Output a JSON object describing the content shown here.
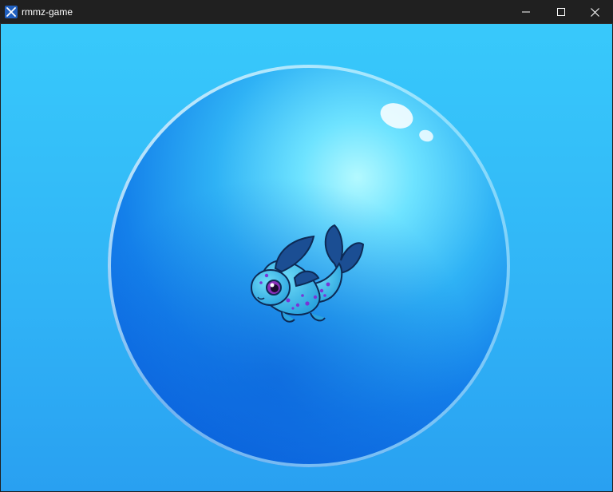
{
  "window": {
    "title": "rmmz-game",
    "app_icon": "rpg-maker-icon",
    "controls": {
      "minimize_icon": "minimize-icon",
      "maximize_icon": "maximize-icon",
      "close_icon": "close-icon"
    }
  },
  "scene": {
    "background_color": "#34BDF8",
    "bubble": {
      "icon": "bubble",
      "core_color": "#0B6FE8",
      "highlight_color": "#A5F4FF",
      "rim_color": "#D8F6FF"
    },
    "creature": {
      "icon": "fish-creature-sprite",
      "body_color": "#39B6E8",
      "fin_color": "#1B4E93",
      "spot_color": "#7A35D6",
      "eye_color": "#8A2FB8"
    }
  },
  "colors": {
    "titlebar": "#202020",
    "title_text": "#FFFFFF",
    "close_hover": "#C42B1C"
  }
}
